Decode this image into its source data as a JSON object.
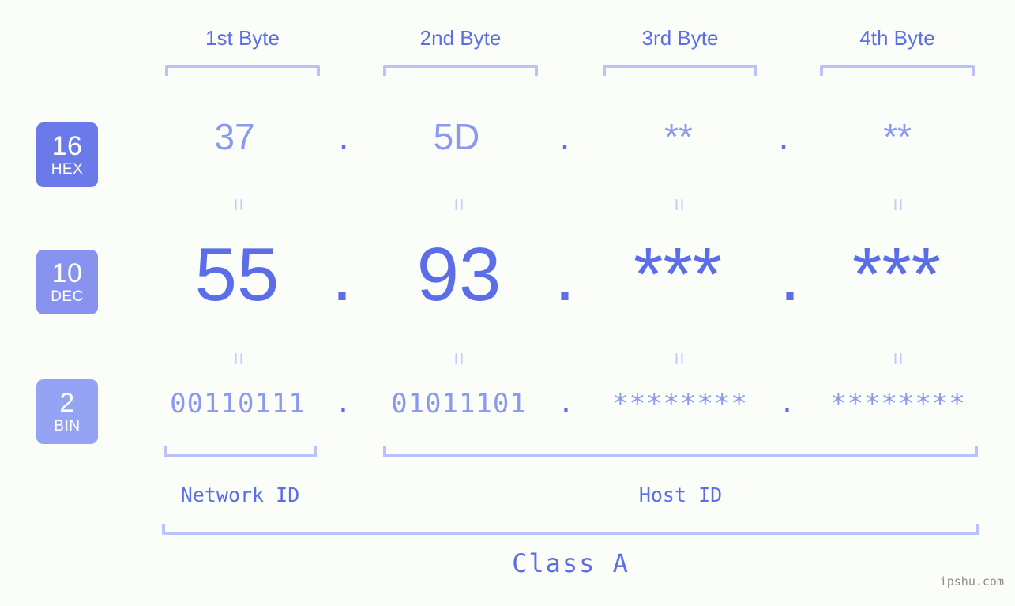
{
  "background_color": "#fbfdf8",
  "accent_color": "#5b6ee8",
  "accent_light_color": "#8b99f2",
  "bracket_color": "#b9c2fb",
  "byte_headers": [
    {
      "label": "1st Byte"
    },
    {
      "label": "2nd Byte"
    },
    {
      "label": "3rd Byte"
    },
    {
      "label": "4th Byte"
    }
  ],
  "bases": [
    {
      "number": "16",
      "name": "HEX",
      "color": "#6a7be9"
    },
    {
      "number": "10",
      "name": "DEC",
      "color": "#8793ef"
    },
    {
      "number": "2",
      "name": "BIN",
      "color": "#95a3f4"
    }
  ],
  "rows": {
    "hex": {
      "values": [
        "37",
        "5D",
        "**",
        "**"
      ],
      "separator": "."
    },
    "dec": {
      "values": [
        "55",
        "93",
        "***",
        "***"
      ],
      "separator": "."
    },
    "bin": {
      "values": [
        "00110111",
        "01011101",
        "********",
        "********"
      ],
      "separator": "."
    }
  },
  "equals_symbol": "=",
  "segments": {
    "network_id": "Network ID",
    "host_id": "Host ID"
  },
  "class_label": "Class A",
  "watermark": "ipshu.com",
  "chart_data": {
    "type": "table",
    "title": "IP Address Byte Breakdown",
    "address_hex": "37.5D.**.**",
    "address_dec": "55.93.***.***",
    "address_bin": "00110111.01011101.********.********",
    "ip_class": "Class A",
    "network_id_bytes": 1,
    "host_id_bytes": 3,
    "columns": [
      "1st Byte",
      "2nd Byte",
      "3rd Byte",
      "4th Byte"
    ],
    "series": [
      {
        "name": "16 HEX",
        "values": [
          "37",
          "5D",
          "**",
          "**"
        ]
      },
      {
        "name": "10 DEC",
        "values": [
          "55",
          "93",
          "***",
          "***"
        ]
      },
      {
        "name": "2 BIN",
        "values": [
          "00110111",
          "01011101",
          "********",
          "********"
        ]
      }
    ]
  }
}
